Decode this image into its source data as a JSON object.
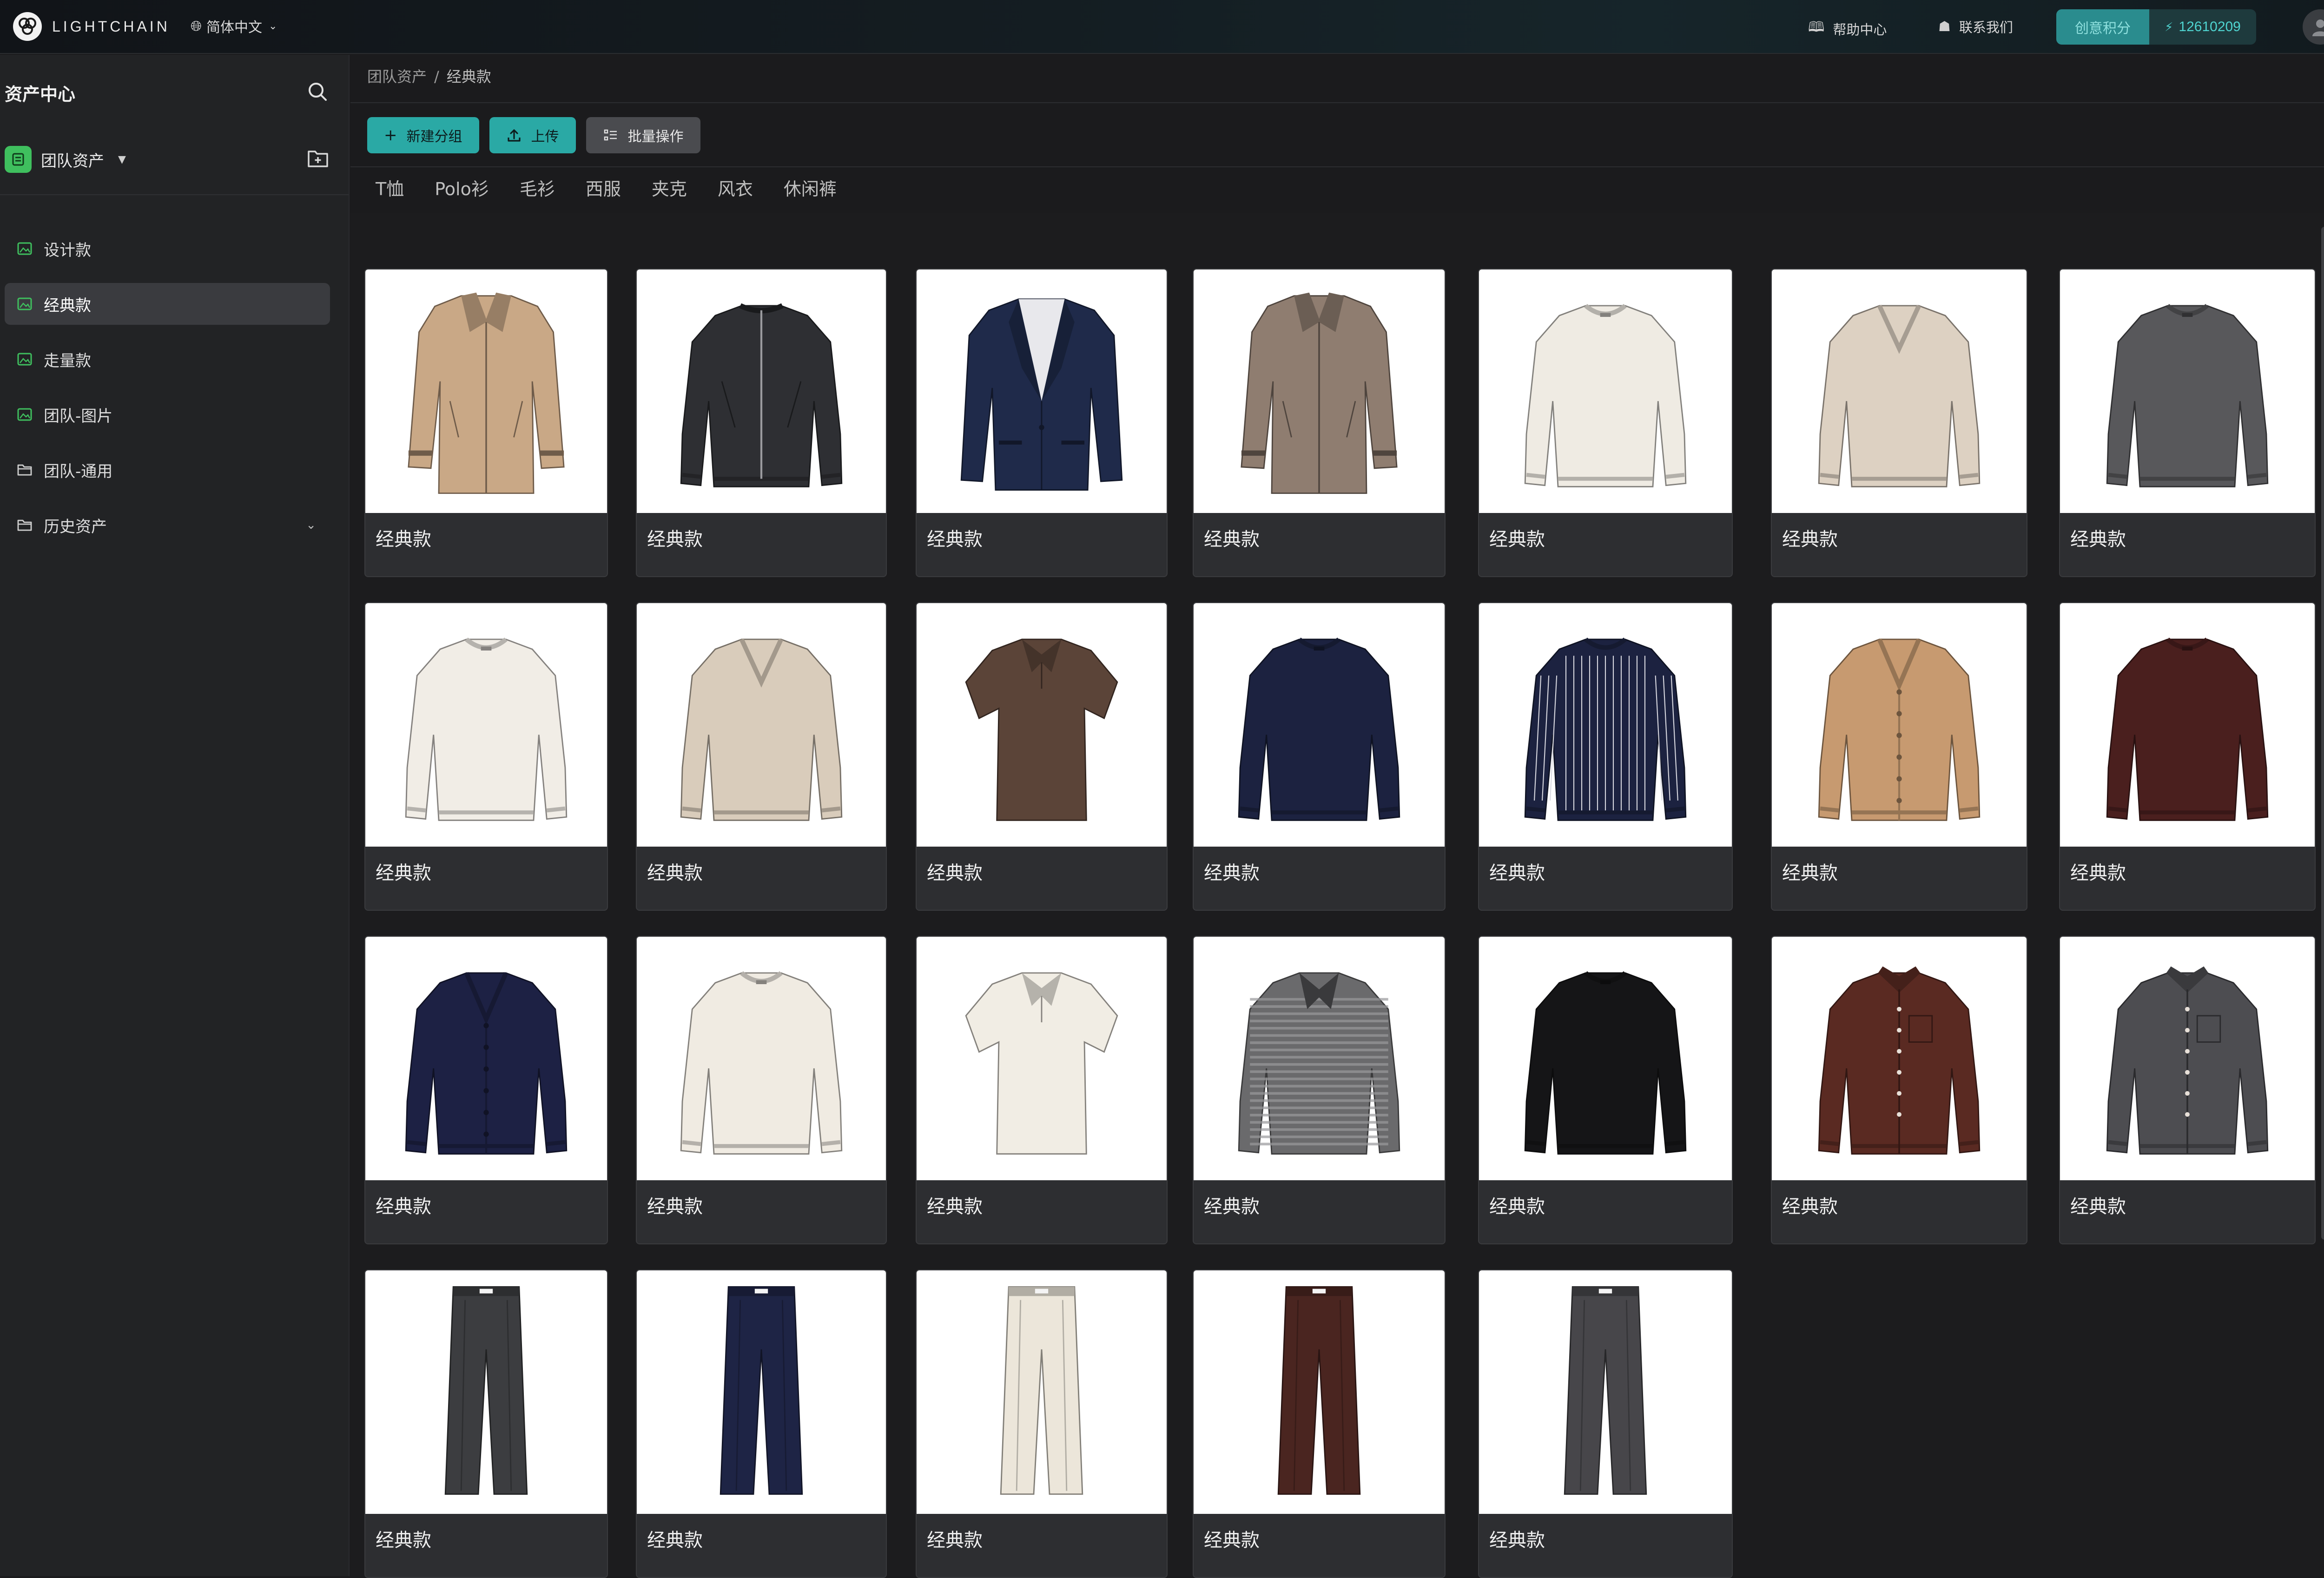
{
  "topbar": {
    "brand": "LIGHTCHAIN",
    "language": "简体中文",
    "help_center": "帮助中心",
    "contact_us": "联系我们",
    "points_label": "创意积分",
    "points_value": "12610209"
  },
  "sidebar": {
    "title": "资产中心",
    "team": "团队资产",
    "items": [
      {
        "label": "设计款",
        "icon": "image-icon"
      },
      {
        "label": "经典款",
        "icon": "image-icon",
        "active": true
      },
      {
        "label": "走量款",
        "icon": "image-icon"
      },
      {
        "label": "团队-图片",
        "icon": "image-icon"
      },
      {
        "label": "团队-通用",
        "icon": "folder-icon"
      },
      {
        "label": "历史资产",
        "icon": "folder-icon",
        "expandable": true
      }
    ]
  },
  "breadcrumb": {
    "root": "团队资产",
    "separator": "/",
    "current": "经典款"
  },
  "toolbar": {
    "new_group": "新建分组",
    "upload": "上传",
    "batch": "批量操作"
  },
  "tabs": [
    "T恤",
    "Polo衫",
    "毛衫",
    "西服",
    "夹克",
    "风衣",
    "休闲裤"
  ],
  "colors": {
    "accent": "#2aa9a5",
    "background": "#1b1b1d",
    "sidebar": "#222325",
    "card": "#2d2e31"
  },
  "assets": [
    {
      "label": "经典款",
      "item": "trench-coat",
      "color": "#c9a886"
    },
    {
      "label": "经典款",
      "item": "zip-jacket",
      "color": "#2e2f33"
    },
    {
      "label": "经典款",
      "item": "blazer",
      "color": "#1f2a4a"
    },
    {
      "label": "经典款",
      "item": "trench-coat",
      "color": "#8f7d70"
    },
    {
      "label": "经典款",
      "item": "crewneck-sweater",
      "color": "#efebe3"
    },
    {
      "label": "经典款",
      "item": "vneck-sweater",
      "color": "#ddd1c2"
    },
    {
      "label": "经典款",
      "item": "crewneck-sweater",
      "color": "#58585b"
    },
    {
      "label": "经典款",
      "item": "crewneck-sweater",
      "color": "#f1ede6"
    },
    {
      "label": "经典款",
      "item": "vneck-sweater",
      "color": "#d9ccbb"
    },
    {
      "label": "经典款",
      "item": "polo-shirt",
      "color": "#5b4438"
    },
    {
      "label": "经典款",
      "item": "crewneck-sweater",
      "color": "#1c2240"
    },
    {
      "label": "经典款",
      "item": "striped-sweater",
      "color": "#1c2240"
    },
    {
      "label": "经典款",
      "item": "cardigan",
      "color": "#c79a70"
    },
    {
      "label": "经典款",
      "item": "crewneck-sweater",
      "color": "#4a1f1e"
    },
    {
      "label": "经典款",
      "item": "cardigan",
      "color": "#1d2144"
    },
    {
      "label": "经典款",
      "item": "crewneck-sweater",
      "color": "#f0ebe2"
    },
    {
      "label": "经典款",
      "item": "polo-shirt",
      "color": "#f1ede4"
    },
    {
      "label": "经典款",
      "item": "striped-polo",
      "color": "#6a6a6c"
    },
    {
      "label": "经典款",
      "item": "crewneck-sweater",
      "color": "#151517"
    },
    {
      "label": "经典款",
      "item": "button-shirt",
      "color": "#5a2a22"
    },
    {
      "label": "经典款",
      "item": "button-shirt",
      "color": "#4d4d51"
    },
    {
      "label": "经典款",
      "item": "trousers",
      "color": "#3c3d40"
    },
    {
      "label": "经典款",
      "item": "trousers",
      "color": "#1e2445"
    },
    {
      "label": "经典款",
      "item": "trousers",
      "color": "#ece6da"
    },
    {
      "label": "经典款",
      "item": "trousers",
      "color": "#4a2520"
    },
    {
      "label": "经典款",
      "item": "trousers",
      "color": "#47464a"
    }
  ]
}
